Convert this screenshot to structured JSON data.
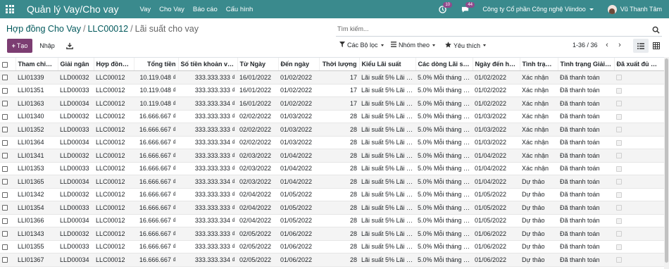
{
  "app": {
    "title": "Quản lý Vay/Cho vay",
    "menu": [
      "Vay",
      "Cho Vay",
      "Báo cáo",
      "Cấu hình"
    ],
    "activities_count": "10",
    "messages_count": "44",
    "company": "Công ty Cổ phần Công nghệ Viindoo",
    "user": "Vũ Thanh Tâm",
    "colors": {
      "navbar": "#3a8a8d",
      "primary_button": "#7c3d72",
      "badge": "#8f4a8c"
    }
  },
  "breadcrumb": {
    "items": [
      "Hợp đồng Cho Vay",
      "LLC00012"
    ],
    "current": "Lãi suất cho vay"
  },
  "search": {
    "placeholder": "Tìm kiếm..."
  },
  "controls": {
    "create": "Tạo",
    "import": "Nhập",
    "filters": "Các Bộ lọc",
    "group_by": "Nhóm theo",
    "favorites": "Yêu thích",
    "pager": "1-36 / 36"
  },
  "table": {
    "columns": [
      "Tham chiếu...",
      "Giải ngân",
      "Hợp đồng...",
      "Tổng tiền",
      "Số tiền khoản vay...",
      "Từ Ngày",
      "Đến ngày",
      "Thời lượng",
      "Kiểu Lãi suất",
      "Các dòng Lãi suất...",
      "Ngày đến hạn...",
      "Tình trạng...",
      "Tình trạng Giải ng...",
      "Đã xuất đủ Hoá đ..."
    ],
    "rows": [
      [
        "LLI01339",
        "LLD00032",
        "LLC00012",
        "10.119.048 ₫",
        "333.333.333 ₫",
        "16/01/2022",
        "01/02/2022",
        "17",
        "Lãi suất 5% Lãi su...",
        "5.0% Mỗi tháng [T...",
        "01/02/2022",
        "Xác nhận",
        "Đã thanh toán"
      ],
      [
        "LLI01351",
        "LLD00033",
        "LLC00012",
        "10.119.048 ₫",
        "333.333.333 ₫",
        "16/01/2022",
        "01/02/2022",
        "17",
        "Lãi suất 5% Lãi su...",
        "5.0% Mỗi tháng [T...",
        "01/02/2022",
        "Xác nhận",
        "Đã thanh toán"
      ],
      [
        "LLI01363",
        "LLD00034",
        "LLC00012",
        "10.119.048 ₫",
        "333.333.334 ₫",
        "16/01/2022",
        "01/02/2022",
        "17",
        "Lãi suất 5% Lãi su...",
        "5.0% Mỗi tháng [T...",
        "01/02/2022",
        "Xác nhận",
        "Đã thanh toán"
      ],
      [
        "LLI01340",
        "LLD00032",
        "LLC00012",
        "16.666.667 ₫",
        "333.333.333 ₫",
        "02/02/2022",
        "01/03/2022",
        "28",
        "Lãi suất 5% Lãi su...",
        "5.0% Mỗi tháng [T...",
        "01/03/2022",
        "Xác nhận",
        "Đã thanh toán"
      ],
      [
        "LLI01352",
        "LLD00033",
        "LLC00012",
        "16.666.667 ₫",
        "333.333.333 ₫",
        "02/02/2022",
        "01/03/2022",
        "28",
        "Lãi suất 5% Lãi su...",
        "5.0% Mỗi tháng [T...",
        "01/03/2022",
        "Xác nhận",
        "Đã thanh toán"
      ],
      [
        "LLI01364",
        "LLD00034",
        "LLC00012",
        "16.666.667 ₫",
        "333.333.334 ₫",
        "02/02/2022",
        "01/03/2022",
        "28",
        "Lãi suất 5% Lãi su...",
        "5.0% Mỗi tháng [T...",
        "01/03/2022",
        "Xác nhận",
        "Đã thanh toán"
      ],
      [
        "LLI01341",
        "LLD00032",
        "LLC00012",
        "16.666.667 ₫",
        "333.333.333 ₫",
        "02/03/2022",
        "01/04/2022",
        "28",
        "Lãi suất 5% Lãi su...",
        "5.0% Mỗi tháng [T...",
        "01/04/2022",
        "Xác nhận",
        "Đã thanh toán"
      ],
      [
        "LLI01353",
        "LLD00033",
        "LLC00012",
        "16.666.667 ₫",
        "333.333.333 ₫",
        "02/03/2022",
        "01/04/2022",
        "28",
        "Lãi suất 5% Lãi su...",
        "5.0% Mỗi tháng [T...",
        "01/04/2022",
        "Xác nhận",
        "Đã thanh toán"
      ],
      [
        "LLI01365",
        "LLD00034",
        "LLC00012",
        "16.666.667 ₫",
        "333.333.334 ₫",
        "02/03/2022",
        "01/04/2022",
        "28",
        "Lãi suất 5% Lãi su...",
        "5.0% Mỗi tháng [T...",
        "01/04/2022",
        "Dự thảo",
        "Đã thanh toán"
      ],
      [
        "LLI01342",
        "LLD00032",
        "LLC00012",
        "16.666.667 ₫",
        "333.333.333 ₫",
        "02/04/2022",
        "01/05/2022",
        "28",
        "Lãi suất 5% Lãi su...",
        "5.0% Mỗi tháng [T...",
        "01/05/2022",
        "Dự thảo",
        "Đã thanh toán"
      ],
      [
        "LLI01354",
        "LLD00033",
        "LLC00012",
        "16.666.667 ₫",
        "333.333.333 ₫",
        "02/04/2022",
        "01/05/2022",
        "28",
        "Lãi suất 5% Lãi su...",
        "5.0% Mỗi tháng [T...",
        "01/05/2022",
        "Dự thảo",
        "Đã thanh toán"
      ],
      [
        "LLI01366",
        "LLD00034",
        "LLC00012",
        "16.666.667 ₫",
        "333.333.334 ₫",
        "02/04/2022",
        "01/05/2022",
        "28",
        "Lãi suất 5% Lãi su...",
        "5.0% Mỗi tháng [T...",
        "01/05/2022",
        "Dự thảo",
        "Đã thanh toán"
      ],
      [
        "LLI01343",
        "LLD00032",
        "LLC00012",
        "16.666.667 ₫",
        "333.333.333 ₫",
        "02/05/2022",
        "01/06/2022",
        "28",
        "Lãi suất 5% Lãi su...",
        "5.0% Mỗi tháng [T...",
        "01/06/2022",
        "Dự thảo",
        "Đã thanh toán"
      ],
      [
        "LLI01355",
        "LLD00033",
        "LLC00012",
        "16.666.667 ₫",
        "333.333.333 ₫",
        "02/05/2022",
        "01/06/2022",
        "28",
        "Lãi suất 5% Lãi su...",
        "5.0% Mỗi tháng [T...",
        "01/06/2022",
        "Dự thảo",
        "Đã thanh toán"
      ],
      [
        "LLI01367",
        "LLD00034",
        "LLC00012",
        "16.666.667 ₫",
        "333.333.334 ₫",
        "02/05/2022",
        "01/06/2022",
        "28",
        "Lãi suất 5% Lãi su...",
        "5.0% Mỗi tháng [T...",
        "01/06/2022",
        "Dự thảo",
        "Đã thanh toán"
      ]
    ]
  }
}
